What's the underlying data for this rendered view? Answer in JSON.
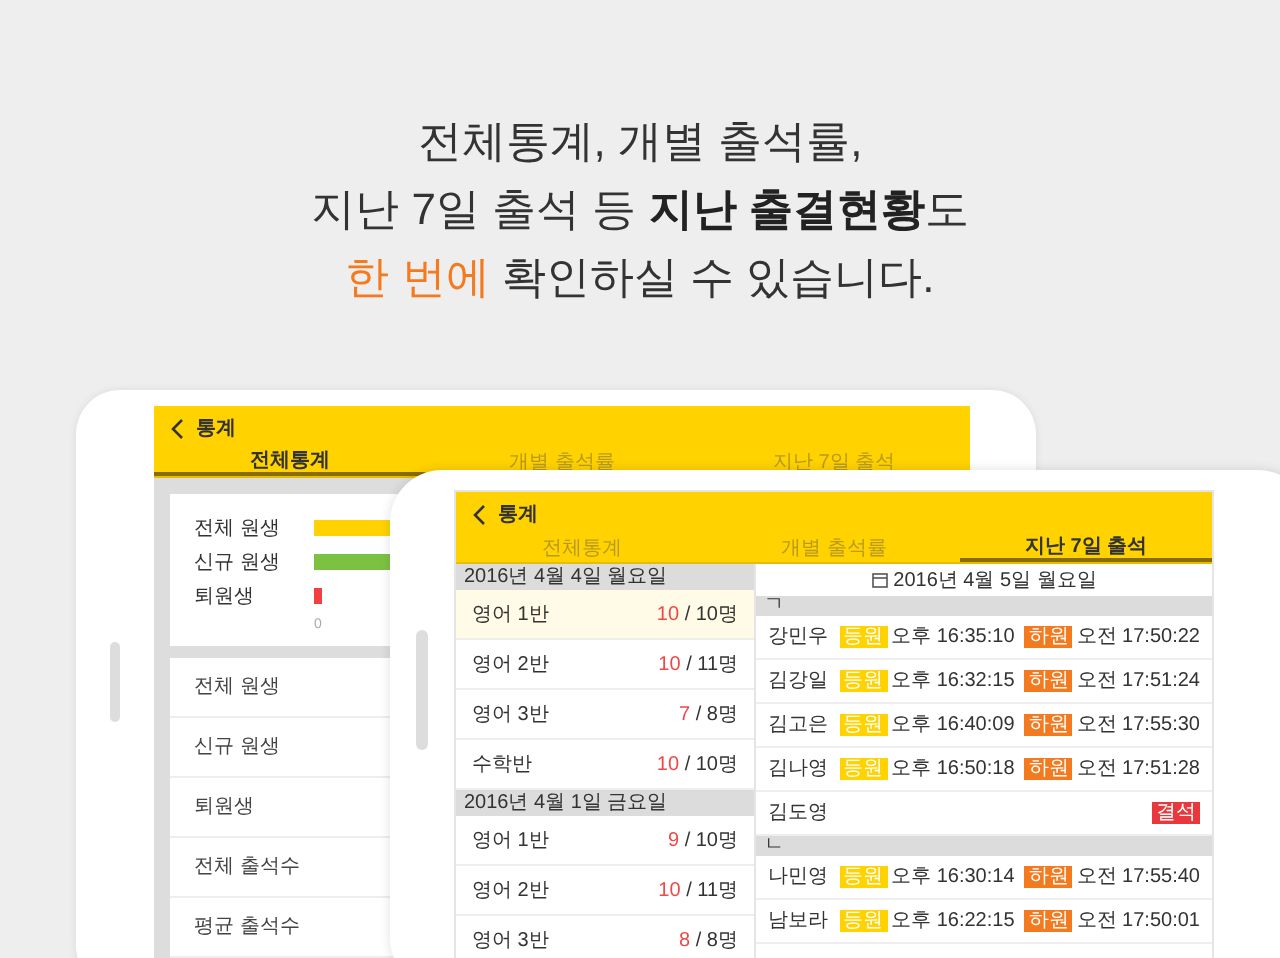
{
  "headline": [
    {
      "segments": [
        {
          "text": "전체통계, 개별 출석률,",
          "kind": "plain"
        }
      ]
    },
    {
      "segments": [
        {
          "text": "지난 7일 출석 등 ",
          "kind": "plain"
        },
        {
          "text": "지난 출결현황",
          "kind": "bold"
        },
        {
          "text": "도",
          "kind": "plain"
        }
      ]
    },
    {
      "segments": [
        {
          "text": "한 번에",
          "kind": "accent"
        },
        {
          "text": " 확인하실 수 있습니다.",
          "kind": "plain"
        }
      ]
    }
  ],
  "back_tablet": {
    "title": "통계",
    "tabs": [
      {
        "label": "전체통계",
        "selected": true
      },
      {
        "label": "개별 출석률",
        "selected": false
      },
      {
        "label": "지난 7일 출석",
        "selected": false
      }
    ],
    "bars": [
      {
        "label": "전체 원생",
        "color": "#ffd200"
      },
      {
        "label": "신규 원생",
        "color": "#7cc242"
      },
      {
        "label": "퇴원생",
        "color": "#f04040"
      }
    ],
    "axis_tick": "0",
    "stats": [
      "전체 원생",
      "신규 원생",
      "퇴원생",
      "전체 출석수",
      "평균 출석수"
    ]
  },
  "front_tablet": {
    "title": "통계",
    "tabs": [
      {
        "label": "전체통계",
        "selected": false
      },
      {
        "label": "개별 출석률",
        "selected": false
      },
      {
        "label": "지난 7일 출석",
        "selected": true
      }
    ],
    "days": [
      {
        "date": "2016년 4월 4일 월요일",
        "classes": [
          {
            "name": "영어 1반",
            "present": "10",
            "total": "/ 10명",
            "selected": true
          },
          {
            "name": "영어 2반",
            "present": "10",
            "total": "/ 11명",
            "selected": false
          },
          {
            "name": "영어 3반",
            "present": "7",
            "total": "/ 8명",
            "selected": false
          },
          {
            "name": "수학반",
            "present": "10",
            "total": "/ 10명",
            "selected": false
          }
        ]
      },
      {
        "date": "2016년 4월 1일 금요일",
        "classes": [
          {
            "name": "영어 1반",
            "present": "9",
            "total": "/ 10명",
            "selected": false
          },
          {
            "name": "영어 2반",
            "present": "10",
            "total": "/ 11명",
            "selected": false
          },
          {
            "name": "영어 3반",
            "present": "8",
            "total": "/ 8명",
            "selected": false
          }
        ]
      }
    ],
    "detail_date": "2016년 4월 5일 월요일",
    "groups": [
      {
        "initial": "ㄱ",
        "students": [
          {
            "name": "강민우",
            "badges": [
              {
                "kind": "in",
                "label": "등원",
                "time": "오후 16:35:10"
              },
              {
                "kind": "out",
                "label": "하원",
                "time": "오전 17:50:22"
              }
            ]
          },
          {
            "name": "김강일",
            "badges": [
              {
                "kind": "in",
                "label": "등원",
                "time": "오후 16:32:15"
              },
              {
                "kind": "out",
                "label": "하원",
                "time": "오전 17:51:24"
              }
            ]
          },
          {
            "name": "김고은",
            "badges": [
              {
                "kind": "in",
                "label": "등원",
                "time": "오후 16:40:09"
              },
              {
                "kind": "out",
                "label": "하원",
                "time": "오전 17:55:30"
              }
            ]
          },
          {
            "name": "김나영",
            "badges": [
              {
                "kind": "in",
                "label": "등원",
                "time": "오후 16:50:18"
              },
              {
                "kind": "out",
                "label": "하원",
                "time": "오전 17:51:28"
              }
            ]
          },
          {
            "name": "김도영",
            "badges": [
              {
                "kind": "absent",
                "label": "결석"
              }
            ]
          }
        ]
      },
      {
        "initial": "ㄴ",
        "students": [
          {
            "name": "나민영",
            "badges": [
              {
                "kind": "in",
                "label": "등원",
                "time": "오후 16:30:14"
              },
              {
                "kind": "out",
                "label": "하원",
                "time": "오전 17:55:40"
              }
            ]
          },
          {
            "name": "남보라",
            "badges": [
              {
                "kind": "in",
                "label": "등원",
                "time": "오후 16:22:15"
              },
              {
                "kind": "out",
                "label": "하원",
                "time": "오전 17:50:01"
              }
            ]
          }
        ]
      }
    ]
  }
}
